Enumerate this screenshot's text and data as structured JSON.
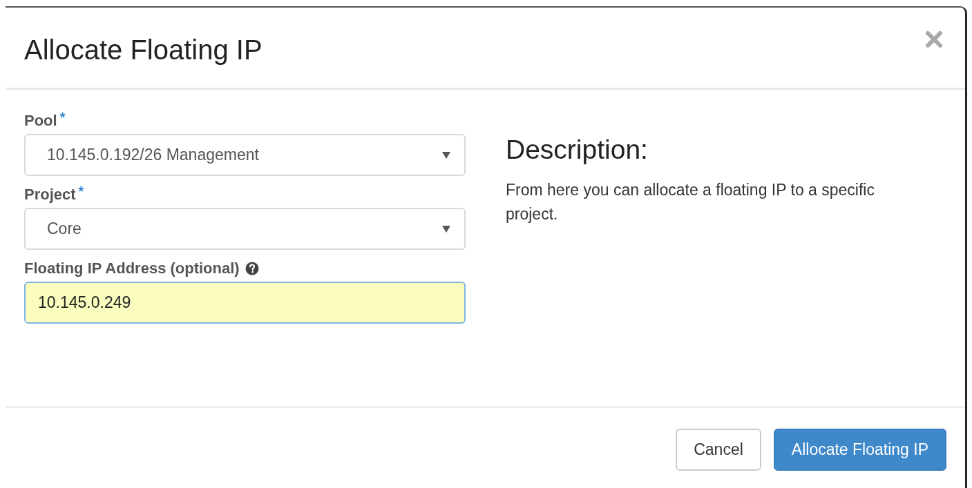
{
  "dialog": {
    "title": "Allocate Floating IP"
  },
  "fields": [
    {
      "kind": "select",
      "label": "Pool",
      "required_mark": "*",
      "help": false,
      "value": "10.145.0.192/26 Management",
      "autofilled": false
    },
    {
      "kind": "select",
      "label": "Project",
      "required_mark": "*",
      "help": false,
      "value": "Core",
      "autofilled": false
    },
    {
      "kind": "text",
      "label": "Floating IP Address (optional)",
      "help": true,
      "value": "10.145.0.249",
      "autofilled": true
    }
  ],
  "description": {
    "heading": "Description:",
    "text": "From here you can allocate a floating IP to a specific project."
  },
  "buttons": [
    {
      "kind": "default",
      "label": "Cancel"
    },
    {
      "kind": "primary",
      "label": "Allocate Floating IP"
    }
  ]
}
